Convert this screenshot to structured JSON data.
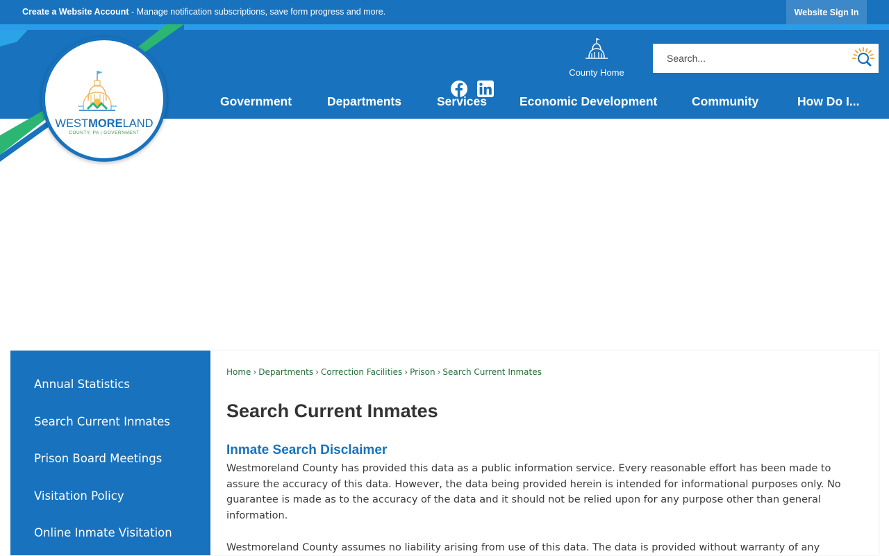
{
  "topbar": {
    "account_link": "Create a Website Account",
    "account_text": " - Manage notification subscriptions, save form progress and more.",
    "signin": "Website Sign In"
  },
  "logo": {
    "name_part1": "WEST",
    "name_part2": "MORE",
    "name_part3": "LAND",
    "subtitle": "COUNTY, PA | GOVERNMENT"
  },
  "header": {
    "social": [
      "facebook-icon",
      "linkedin-icon"
    ],
    "county_home": "County Home",
    "search_placeholder": "Search..."
  },
  "nav": {
    "items": [
      "Government",
      "Departments",
      "Services",
      "Economic Development",
      "Community",
      "How Do I..."
    ]
  },
  "sidebar": {
    "items": [
      "Annual Statistics",
      "Search Current Inmates",
      "Prison Board Meetings",
      "Visitation Policy",
      "Online Inmate Visitation"
    ]
  },
  "breadcrumb": {
    "items": [
      "Home",
      "Departments",
      "Correction Facilities",
      "Prison",
      "Search Current Inmates"
    ]
  },
  "content": {
    "title": "Search Current Inmates",
    "subheading": "Inmate Search Disclaimer",
    "paragraph1": "Westmoreland County has provided this data as a public information service. Every reasonable effort has been made to assure the accuracy of this data. However, the data being provided herein is intended for informational purposes only. No guarantee is made as to the accuracy of the data and it should not be relied upon for any purpose other than general information.",
    "paragraph2": "Westmoreland County assumes no liability arising from use of this data. The data is provided without warranty of any"
  },
  "colors": {
    "brand_blue": "#1872bd",
    "accent_green": "#2bb673",
    "link_green": "#27703b"
  }
}
